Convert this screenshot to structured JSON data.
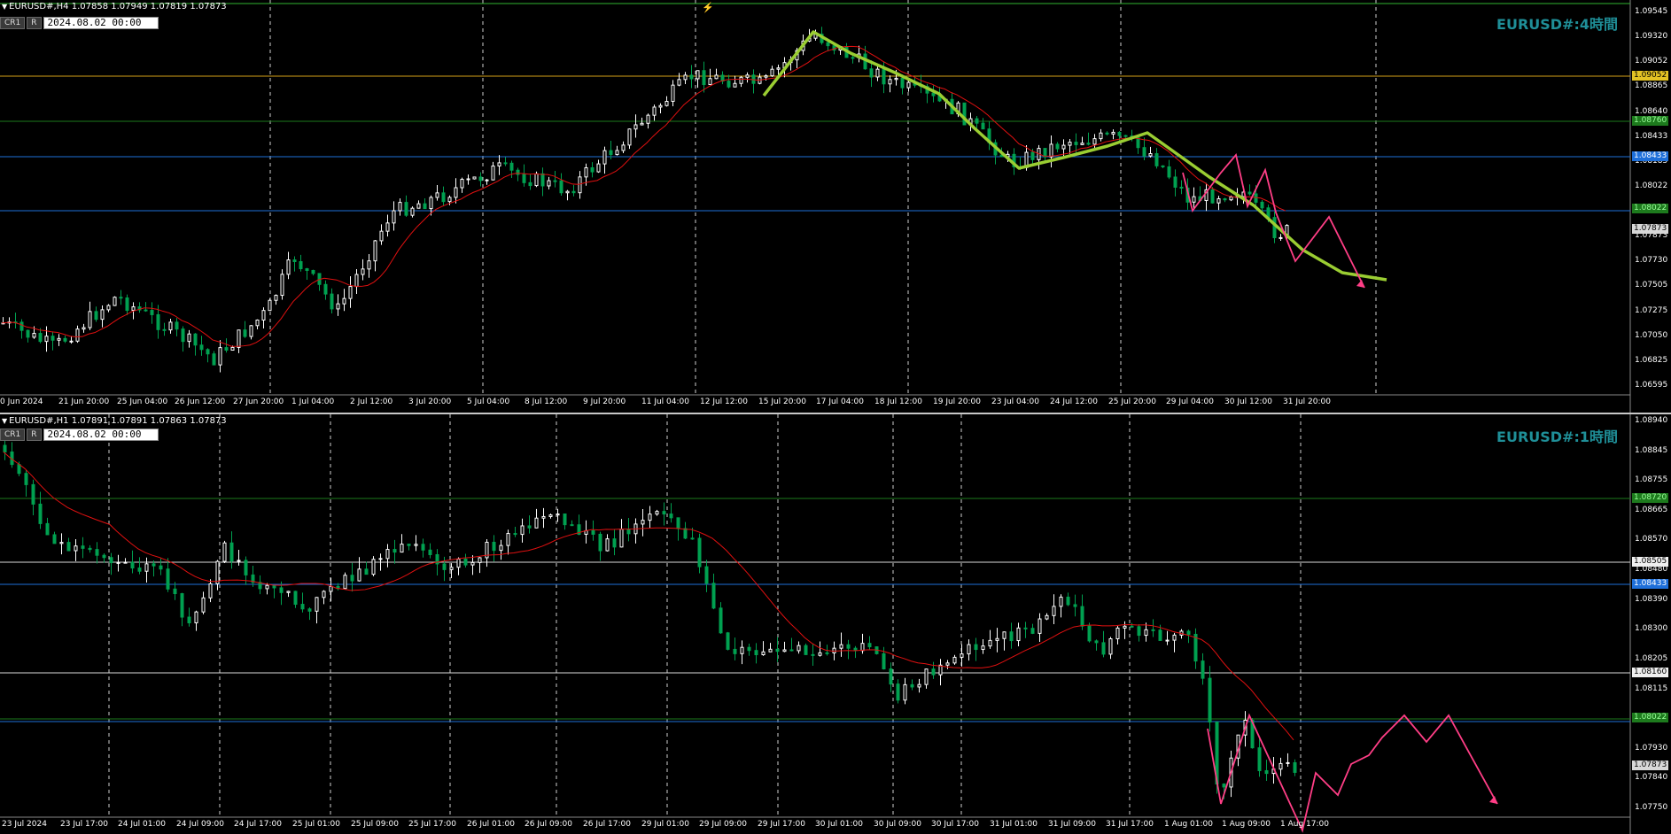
{
  "h4": {
    "ohlc_text": "EURUSD#,H4  1.07858 1.07949 1.07819 1.07873",
    "btn_cr1": "CR1",
    "btn_r": "R",
    "date_value": "2024.08.02 00:00",
    "title": "EURUSD#:4時間",
    "price_axis": [
      "1.09545",
      "1.09320",
      "1.09052",
      "1.08865",
      "1.08640",
      "1.08433",
      "1.08185",
      "1.08022",
      "1.07960",
      "1.07873",
      "1.07730",
      "1.07505",
      "1.07275",
      "1.07050",
      "1.06825",
      "1.06595"
    ],
    "time_axis": [
      "0 Jun 2024",
      "21 Jun 20:00",
      "25 Jun 04:00",
      "26 Jun 12:00",
      "27 Jun 20:00",
      "1 Jul 04:00",
      "2 Jul 12:00",
      "3 Jul 20:00",
      "5 Jul 04:00",
      "8 Jul 12:00",
      "9 Jul 20:00",
      "11 Jul 04:00",
      "12 Jul 12:00",
      "15 Jul 20:00",
      "17 Jul 04:00",
      "18 Jul 12:00",
      "19 Jul 20:00",
      "23 Jul 04:00",
      "24 Jul 12:00",
      "25 Jul 20:00",
      "29 Jul 04:00",
      "30 Jul 12:00",
      "31 Jul 20:00"
    ],
    "tags": {
      "orange_line": "1.09052",
      "green_line": "1.08760",
      "blue_line": "1.08433",
      "green_line2": "1.08022",
      "current": "1.07873"
    }
  },
  "h1": {
    "ohlc_text": "EURUSD#,H1  1.07891 1.07891 1.07863 1.07873",
    "btn_cr1": "CR1",
    "btn_r": "R",
    "date_value": "2024.08.02 00:00",
    "title": "EURUSD#:1時間",
    "price_axis": [
      "1.08940",
      "1.08845",
      "1.08755",
      "1.08665",
      "1.08570",
      "1.08480",
      "1.08390",
      "1.08300",
      "1.08205",
      "1.08115",
      "1.08025",
      "1.07930",
      "1.07840",
      "1.07750"
    ],
    "time_axis": [
      "23 Jul 2024",
      "23 Jul 17:00",
      "24 Jul 01:00",
      "24 Jul 09:00",
      "24 Jul 17:00",
      "25 Jul 01:00",
      "25 Jul 09:00",
      "25 Jul 17:00",
      "26 Jul 01:00",
      "26 Jul 09:00",
      "26 Jul 17:00",
      "29 Jul 01:00",
      "29 Jul 09:00",
      "29 Jul 17:00",
      "30 Jul 01:00",
      "30 Jul 09:00",
      "30 Jul 17:00",
      "31 Jul 01:00",
      "31 Jul 09:00",
      "31 Jul 17:00",
      "1 Aug 01:00",
      "1 Aug 09:00",
      "1 Aug 17:00"
    ],
    "tags": {
      "green_line": "1.08720",
      "white_line1": "1.08505",
      "blue_line": "1.08433",
      "white_line2": "1.08160",
      "green_line2": "1.08022",
      "current": "1.07873"
    }
  },
  "colors": {
    "background": "#000000",
    "bull_candle": "#ffffff",
    "bear_candle": "#00a050",
    "ma_line": "#e01010",
    "trend_line": "#9acd32",
    "forecast_line": "#ff3e86",
    "blue_level": "#1e6fd9",
    "orange_level": "#d4a017",
    "green_level": "#1d7a1d",
    "title_color": "#1f8f98"
  }
}
